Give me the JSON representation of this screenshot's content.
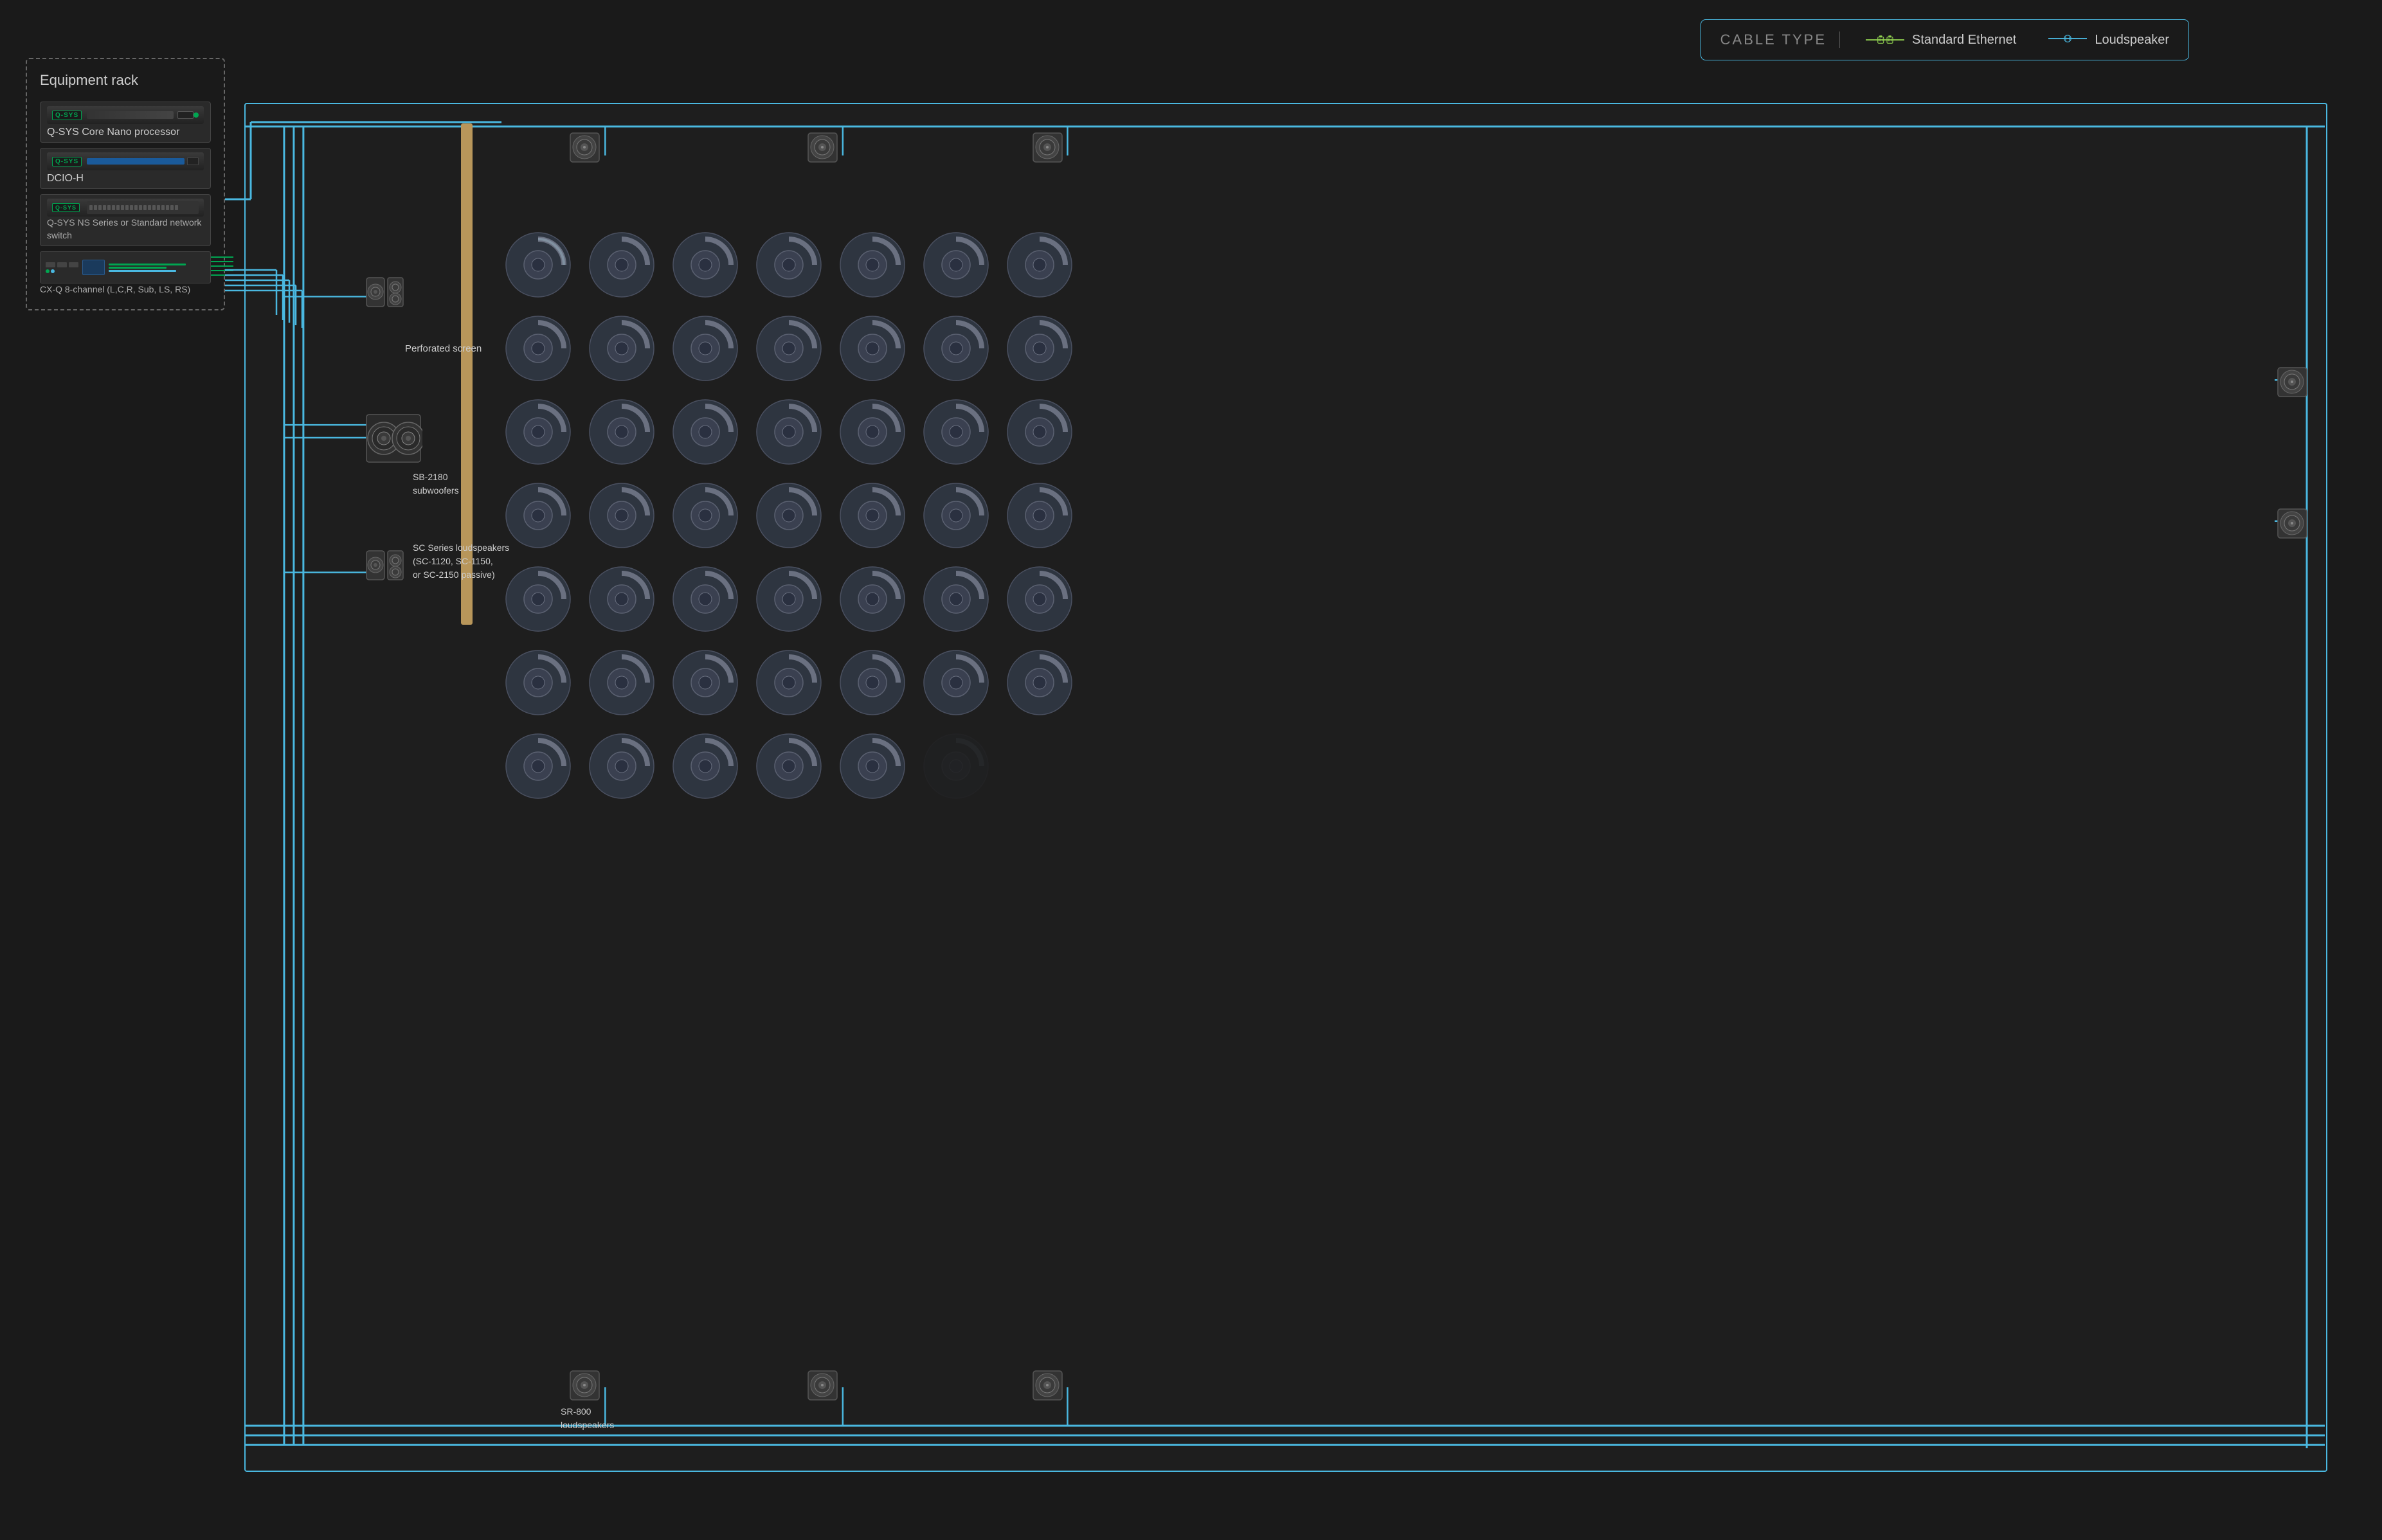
{
  "legend": {
    "title": "CABLE TYPE",
    "items": [
      {
        "name": "Standard Ethernet",
        "type": "ethernet"
      },
      {
        "name": "Loudspeaker",
        "type": "speaker"
      }
    ]
  },
  "rack": {
    "title": "Equipment rack",
    "devices": [
      {
        "id": "qsys-core",
        "brand": "Q-SYS",
        "name": "Q-SYS Core Nano processor"
      },
      {
        "id": "dcio-h",
        "brand": "Q-SYS",
        "name": "DCIO-H"
      },
      {
        "id": "ns-switch",
        "brand": "Q-SYS",
        "name": "Q-SYS NS Series or Standard network switch"
      },
      {
        "id": "cxq",
        "brand": "",
        "name": "CX-Q 8-channel (L,C,R, Sub, LS, RS)"
      }
    ]
  },
  "theater": {
    "screen_label": "Perforated screen",
    "speakers": {
      "front_top": [
        "SR-800",
        "SR-800",
        "SR-800"
      ],
      "side_right": [
        "SR-800",
        "SR-800"
      ],
      "bottom_row": [
        "SR-800 loudspeakers",
        "SR-800",
        "SR-800"
      ],
      "sc_series_label": "SC Series loudspeakers\n(SC-1120, SC-1150,\nor SC-2150 passive)",
      "subwoofer_label": "SB-2180\nsubwoofers",
      "sr800_label": "SR-800\nloudspeakers",
      "ceiling_rows": 7,
      "ceiling_cols": 7
    }
  },
  "colors": {
    "ethernet_line": "#4ab8e0",
    "speaker_line": "#4ab8e0",
    "green_accent": "#00a651",
    "background": "#1a1a1a",
    "border": "#4ab8e0"
  }
}
